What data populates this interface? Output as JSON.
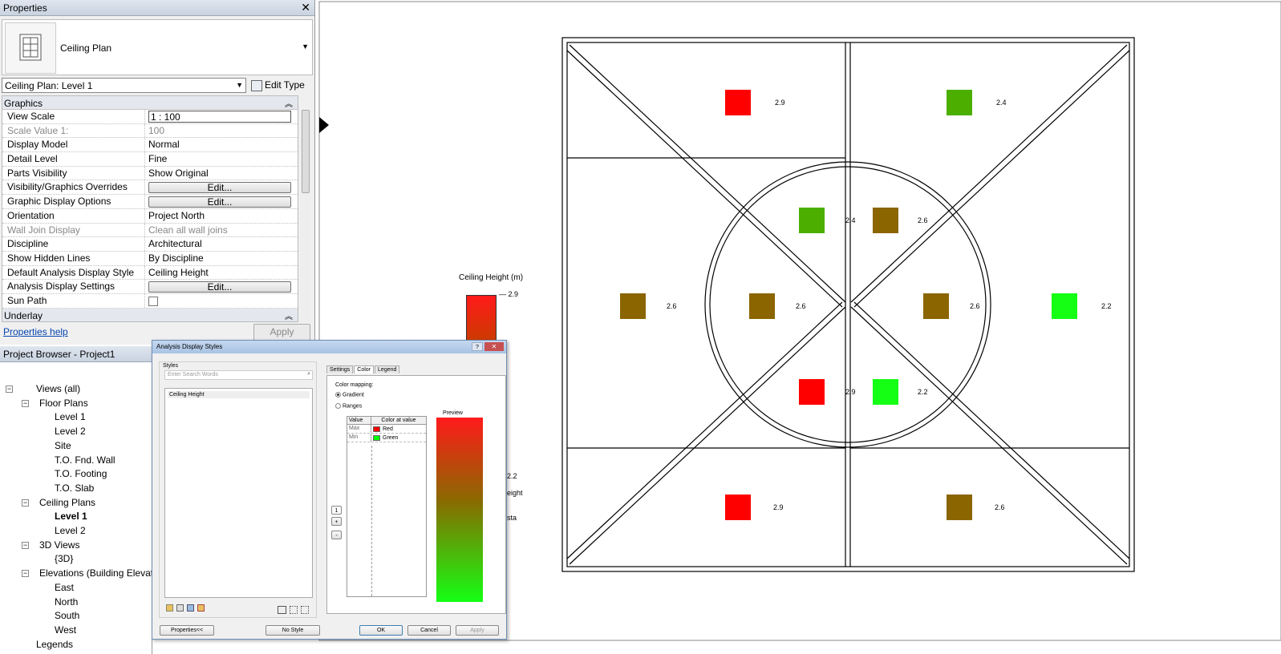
{
  "properties": {
    "title": "Properties",
    "type_name": "Ceiling Plan",
    "view_selector": "Ceiling Plan: Level 1",
    "edit_type": "Edit Type",
    "sections": {
      "graphics": "Graphics",
      "underlay": "Underlay"
    },
    "rows": [
      {
        "label": "View Scale",
        "value": "1 : 100"
      },
      {
        "label": "Scale Value    1:",
        "value": "100"
      },
      {
        "label": "Display Model",
        "value": "Normal"
      },
      {
        "label": "Detail Level",
        "value": "Fine"
      },
      {
        "label": "Parts Visibility",
        "value": "Show Original"
      },
      {
        "label": "Visibility/Graphics Overrides",
        "value": "Edit..."
      },
      {
        "label": "Graphic Display Options",
        "value": "Edit..."
      },
      {
        "label": "Orientation",
        "value": "Project North"
      },
      {
        "label": "Wall Join Display",
        "value": "Clean all wall joins"
      },
      {
        "label": "Discipline",
        "value": "Architectural"
      },
      {
        "label": "Show Hidden Lines",
        "value": "By Discipline"
      },
      {
        "label": "Default Analysis Display Style",
        "value": "Ceiling Height"
      },
      {
        "label": "Analysis Display Settings",
        "value": "Edit..."
      },
      {
        "label": "Sun Path",
        "value": ""
      }
    ],
    "help_link": "Properties help",
    "apply": "Apply"
  },
  "browser": {
    "title": "Project Browser - Project1",
    "items": [
      {
        "label": "Views (all)"
      },
      {
        "label": "Floor Plans"
      },
      {
        "label": "Level 1"
      },
      {
        "label": "Level 2"
      },
      {
        "label": "Site"
      },
      {
        "label": "T.O. Fnd. Wall"
      },
      {
        "label": "T.O. Footing"
      },
      {
        "label": "T.O. Slab"
      },
      {
        "label": "Ceiling Plans"
      },
      {
        "label": "Level 1"
      },
      {
        "label": "Level 2"
      },
      {
        "label": "3D Views"
      },
      {
        "label": "{3D}"
      },
      {
        "label": "Elevations (Building Elevati"
      },
      {
        "label": "East"
      },
      {
        "label": "North"
      },
      {
        "label": "South"
      },
      {
        "label": "West"
      },
      {
        "label": "Legends"
      }
    ]
  },
  "dialog": {
    "title": "Analysis Display Styles",
    "styles_label": "Styles",
    "search_placeholder": "Enter Search Words",
    "style_item": "Ceiling Height",
    "tabs": [
      "Settings",
      "Color",
      "Legend"
    ],
    "color_mapping": "Color mapping:",
    "gradient": "Gradient",
    "ranges": "Ranges",
    "col_value": "Value",
    "col_color": "Color at value",
    "rows": [
      {
        "value": "Max",
        "color_name": "Red",
        "color": "#ff0000"
      },
      {
        "value": "Min",
        "color_name": "Green",
        "color": "#00ff00"
      }
    ],
    "preview": "Preview",
    "stepper_value": "1",
    "plus": "+",
    "minus": "-",
    "properties_btn": "Properties<<",
    "nostyle_btn": "No Style",
    "ok": "OK",
    "cancel": "Cancel",
    "apply": "Apply"
  },
  "legend": {
    "title": "Ceiling Height (m)",
    "max": "2.9",
    "min": "2.2",
    "partial1": "eight",
    "partial2": "sta"
  },
  "markers": [
    {
      "value": "2.9",
      "color": "#ff0000"
    },
    {
      "value": "2.4",
      "color": "#4caf00"
    },
    {
      "value": "2.4",
      "color": "#4caf00"
    },
    {
      "value": "2.6",
      "color": "#8b6500"
    },
    {
      "value": "2.6",
      "color": "#8b6500"
    },
    {
      "value": "2.6",
      "color": "#8b6500"
    },
    {
      "value": "2.6",
      "color": "#8b6500"
    },
    {
      "value": "2.2",
      "color": "#14ff14"
    },
    {
      "value": "2.9",
      "color": "#ff0000"
    },
    {
      "value": "2.2",
      "color": "#14ff14"
    },
    {
      "value": "2.9",
      "color": "#ff0000"
    },
    {
      "value": "2.6",
      "color": "#8b6500"
    }
  ]
}
